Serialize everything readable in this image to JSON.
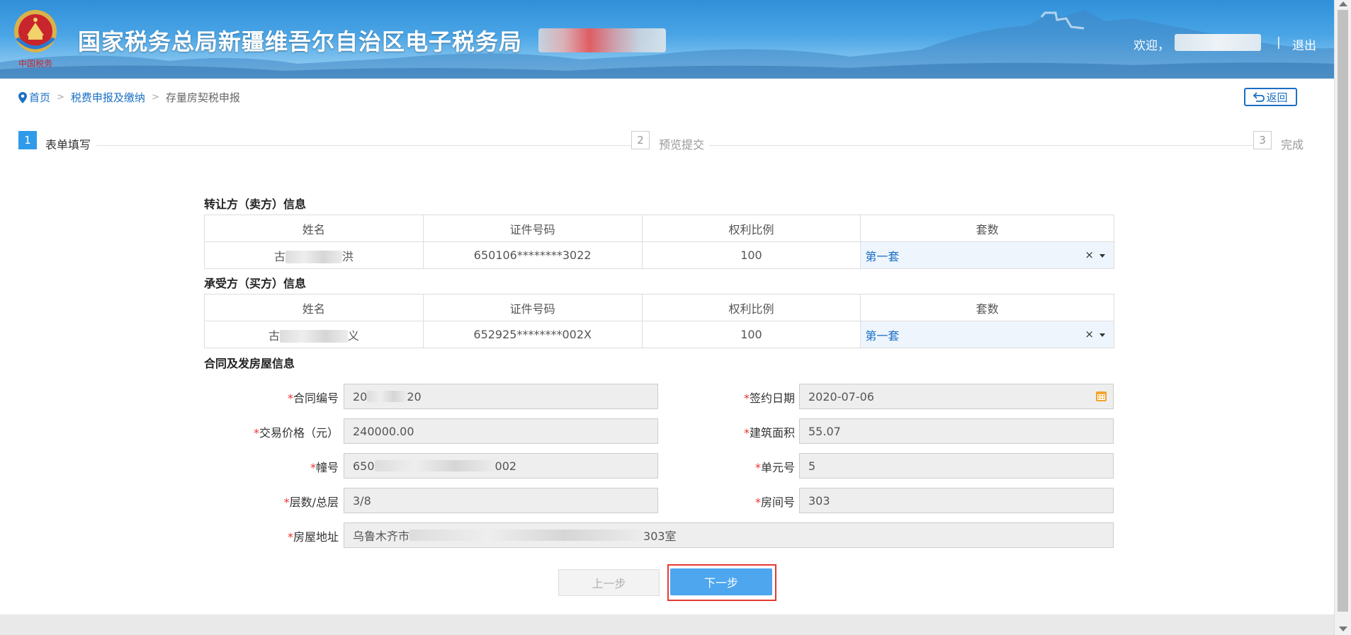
{
  "header": {
    "site_title": "国家税务总局新疆维吾尔自治区电子税务局",
    "welcome": "欢迎，",
    "separator": "|",
    "logout": "退出",
    "emblem_text": "中国税务"
  },
  "breadcrumb": {
    "home": "首页",
    "level2": "税费申报及缴纳",
    "current": "存量房契税申报",
    "separator": ">"
  },
  "back_button": "返回",
  "steps": [
    {
      "num": "1",
      "label": "表单填写",
      "state": "active"
    },
    {
      "num": "2",
      "label": "预览提交",
      "state": "todo"
    },
    {
      "num": "3",
      "label": "完成",
      "state": "todo"
    }
  ],
  "seller": {
    "title": "转让方（卖方）信息",
    "headers": [
      "姓名",
      "证件号码",
      "权利比例",
      "套数"
    ],
    "row": {
      "name_start": "古",
      "name_end": "洪",
      "id": "650106********3022",
      "ratio": "100",
      "sets": "第一套",
      "clear": "×"
    }
  },
  "buyer": {
    "title": "承受方（买方）信息",
    "headers": [
      "姓名",
      "证件号码",
      "权利比例",
      "套数"
    ],
    "row": {
      "name_start": "古",
      "name_end": "义",
      "id": "652925********002X",
      "ratio": "100",
      "sets": "第一套",
      "clear": "×"
    }
  },
  "contract": {
    "title": "合同及发房屋信息",
    "required_mark": "*",
    "fields": {
      "contract_no": {
        "label": "合同编号",
        "value_start": "20",
        "value_end": "20"
      },
      "sign_date": {
        "label": "签约日期",
        "value": "2020-07-06"
      },
      "price": {
        "label": "交易价格（元）",
        "value": "240000.00"
      },
      "area": {
        "label": "建筑面积",
        "value": "55.07"
      },
      "building": {
        "label": "幢号",
        "value_start": "650",
        "value_end": "002"
      },
      "unit": {
        "label": "单元号",
        "value": "5"
      },
      "floor": {
        "label": "层数/总层",
        "value": "3/8"
      },
      "room": {
        "label": "房间号",
        "value": "303"
      },
      "address": {
        "label": "房屋地址",
        "value_start": "乌鲁木齐市",
        "value_end": "303室"
      }
    }
  },
  "buttons": {
    "prev": "上一步",
    "next": "下一步"
  },
  "colors": {
    "primary": "#1a6fc4",
    "step_active": "#2f9be8",
    "next_button": "#4da6ee",
    "highlight_outline": "#e53935",
    "required": "#e33"
  }
}
